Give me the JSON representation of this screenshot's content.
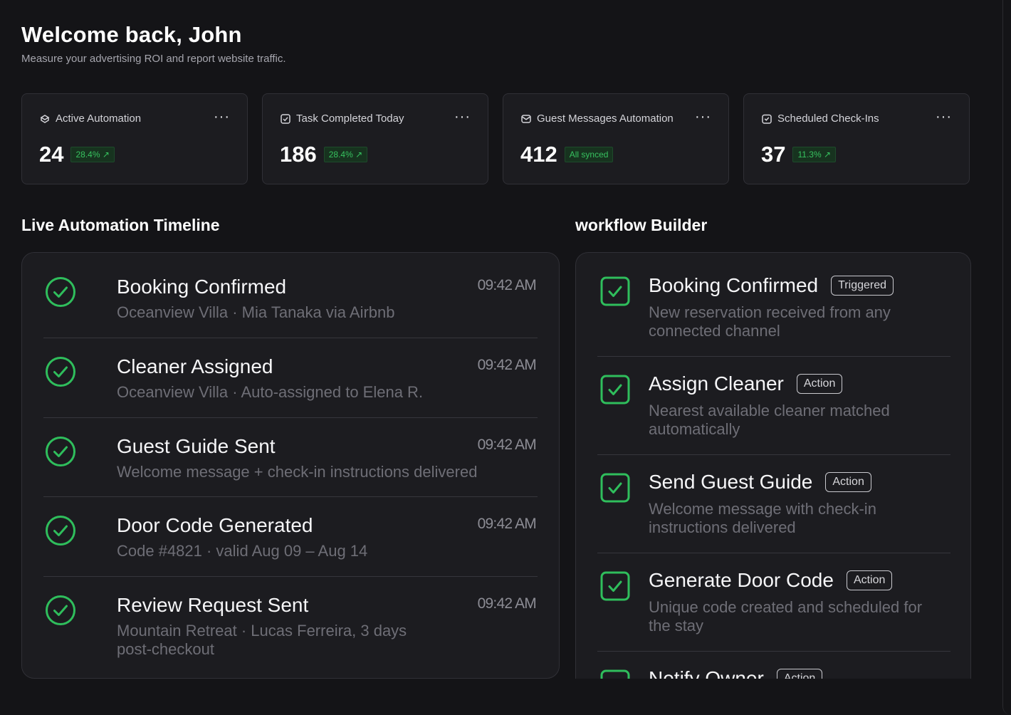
{
  "header": {
    "title": "Welcome back, John",
    "subtitle": "Measure your advertising ROI and report website traffic."
  },
  "stats": [
    {
      "icon": "robot-icon",
      "label": "Active Automation",
      "value": "24",
      "badge": "28.4% ↗"
    },
    {
      "icon": "checkbox-icon",
      "label": "Task Completed Today",
      "value": "186",
      "badge": "28.4% ↗"
    },
    {
      "icon": "message-icon",
      "label": "Guest Messages Automation",
      "value": "412",
      "badge": "All synced"
    },
    {
      "icon": "calendar-check-icon",
      "label": "Scheduled Check-Ins",
      "value": "37",
      "badge": "11.3% ↗"
    }
  ],
  "stat_menu_label": "···",
  "timeline": {
    "title": "Live Automation Timeline",
    "items": [
      {
        "title": "Booking Confirmed",
        "subtitle": "Oceanview Villa · Mia Tanaka via Airbnb",
        "time": "09:42 AM"
      },
      {
        "title": "Cleaner Assigned",
        "subtitle": "Oceanview Villa · Auto-assigned to Elena R.",
        "time": "09:42 AM"
      },
      {
        "title": "Guest Guide Sent",
        "subtitle": "Welcome message + check-in instructions delivered",
        "time": "09:42 AM"
      },
      {
        "title": "Door Code Generated",
        "subtitle": "Code #4821 · valid Aug 09 – Aug 14",
        "time": "09:42 AM"
      },
      {
        "title": "Review Request Sent",
        "subtitle": "Mountain Retreat · Lucas Ferreira, 3 days post-checkout",
        "time": "09:42 AM"
      }
    ]
  },
  "workflow": {
    "title": "workflow Builder",
    "items": [
      {
        "title": "Booking Confirmed",
        "tag": "Triggered",
        "subtitle": "New reservation received from any connected channel"
      },
      {
        "title": "Assign Cleaner",
        "tag": "Action",
        "subtitle": "Nearest available cleaner matched automatically"
      },
      {
        "title": "Send Guest Guide",
        "tag": "Action",
        "subtitle": "Welcome message with check-in instructions delivered"
      },
      {
        "title": "Generate Door Code",
        "tag": "Action",
        "subtitle": "Unique code created and scheduled for the stay"
      },
      {
        "title": "Notify Owner",
        "tag": "Action",
        "subtitle": ""
      }
    ]
  },
  "colors": {
    "accent_green": "#37c25f",
    "background": "#141417",
    "card": "#1c1c20"
  }
}
